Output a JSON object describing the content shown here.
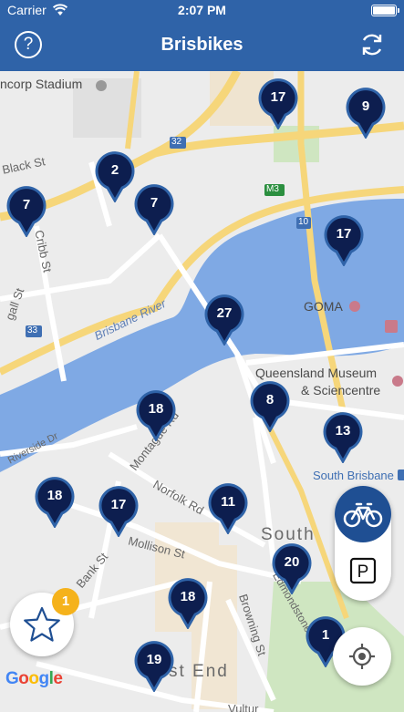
{
  "status_bar": {
    "carrier": "Carrier",
    "time": "2:07 PM"
  },
  "header": {
    "title": "Brisbikes",
    "help_label": "?"
  },
  "map": {
    "labels": {
      "stadium": "ncorp Stadium",
      "black_st": "Black St",
      "cribb_st": "Cribb St",
      "gall_st": "gall St",
      "brisbane_river": "Brisbane River",
      "riverside_dr": "Riverside Dr",
      "montague_rd": "Montague Rd",
      "norfolk_rd": "Norfolk Rd",
      "mollison_st": "Mollison St",
      "bank_st": "Bank St",
      "browning_st": "Browning St",
      "edmondstone_st": "Edmondstone St",
      "goma": "GOMA",
      "qld_museum_1": "Queensland Museum",
      "qld_museum_2": "& Sciencentre",
      "south_brisbane_station": "South Brisbane",
      "south_brisbane": "South",
      "west_end": "st End",
      "vulture": "Vultur",
      "route_32": "32",
      "route_33": "33",
      "route_m3": "M3",
      "route_10": "10"
    },
    "stations": [
      {
        "id": "s1",
        "count": "17"
      },
      {
        "id": "s2",
        "count": "9"
      },
      {
        "id": "s3",
        "count": "2"
      },
      {
        "id": "s4",
        "count": "7"
      },
      {
        "id": "s5",
        "count": "7"
      },
      {
        "id": "s6",
        "count": "17"
      },
      {
        "id": "s7",
        "count": "27"
      },
      {
        "id": "s8",
        "count": "18"
      },
      {
        "id": "s9",
        "count": "8"
      },
      {
        "id": "s10",
        "count": "13"
      },
      {
        "id": "s11",
        "count": "18"
      },
      {
        "id": "s12",
        "count": "17"
      },
      {
        "id": "s13",
        "count": "11"
      },
      {
        "id": "s14",
        "count": "20"
      },
      {
        "id": "s15",
        "count": "18"
      },
      {
        "id": "s16",
        "count": "1"
      },
      {
        "id": "s17",
        "count": "19"
      }
    ],
    "attribution": "Google"
  },
  "controls": {
    "parking_label": "P",
    "favorites_badge": "1"
  },
  "colors": {
    "header": "#2f63a8",
    "marker": "#0d1e4f",
    "marker_border": "#2f63a8",
    "water": "#7fa9e4",
    "badge": "#f5b21b"
  },
  "icons": {
    "wifi": "wifi-icon",
    "battery": "battery-icon",
    "help": "help-icon",
    "refresh": "refresh-icon",
    "bicycle": "bicycle-icon",
    "parking": "parking-icon",
    "locate": "crosshair-icon",
    "favorites": "star-icon"
  }
}
